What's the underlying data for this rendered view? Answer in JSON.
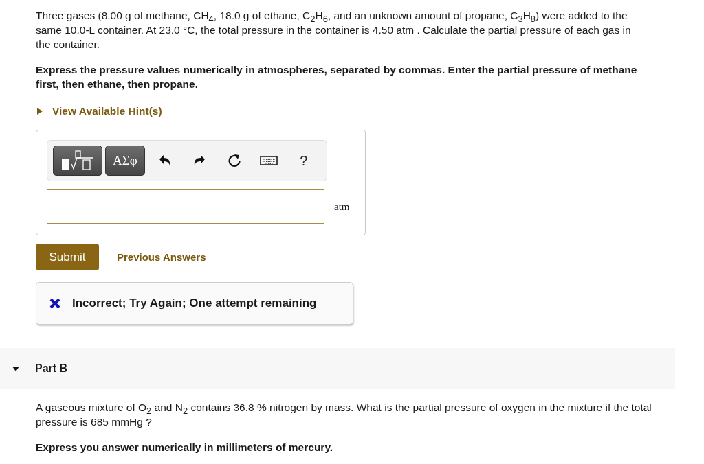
{
  "part_a": {
    "question": "Three gases (8.00 g of methane, CH$_{4}$, 18.0 g of ethane, C$_{2}$H$_{6}$, and an unknown amount of propane, C$_{3}$H$_{8}$) were added to the same 10.0-L container. At 23.0 °C, the total pressure in the container is 4.50 atm . Calculate the partial pressure of each gas in the container.",
    "instruction": "Express the pressure values numerically in atmospheres, separated by commas. Enter the partial pressure of methane first, then ethane, then propane.",
    "hints": {
      "label": "View Available Hint(s)",
      "expanded": false
    },
    "toolbar": {
      "symbols_button": "ΑΣφ",
      "help": "?"
    },
    "answer": {
      "unit": "atm"
    },
    "submit": "Submit",
    "previous_answers": "Previous Answers",
    "feedback": {
      "kind": "incorrect",
      "text": "Incorrect; Try Again; One attempt remaining"
    }
  },
  "part_b": {
    "title": "Part B",
    "expanded": true,
    "question": "A gaseous mixture of O$_{2}$ and N$_{2}$ contains 36.8 % nitrogen by mass. What is the partial pressure of oxygen in the mixture if the total pressure is 685 mmHg ?",
    "instruction": "Express you answer numerically in millimeters of mercury."
  }
}
